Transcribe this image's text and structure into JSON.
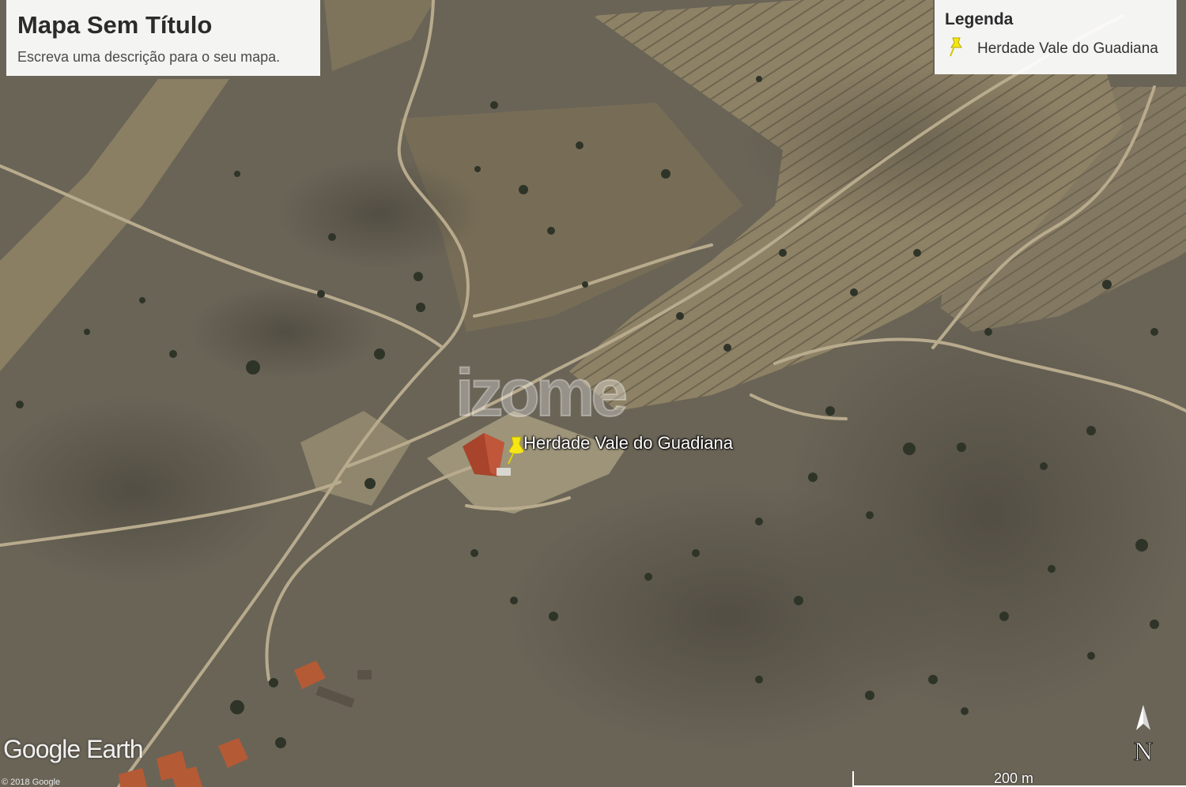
{
  "map": {
    "title": "Mapa Sem Título",
    "description": "Escreva uma descrição para o seu mapa.",
    "legend": {
      "heading": "Legenda",
      "items": [
        {
          "label": "Herdade Vale do Guadiana",
          "icon": "yellow-pushpin-icon"
        }
      ]
    },
    "placemark": {
      "label": "Herdade Vale do Guadiana",
      "icon": "yellow-pushpin-icon",
      "color": "#f5e614"
    },
    "watermark": "izome",
    "branding": {
      "logo": "Google Earth",
      "copyright": "© 2018 Google"
    },
    "compass": {
      "label": "N"
    },
    "scale_bar": {
      "label": "200 m"
    },
    "colors": {
      "terrain": "#6a6457",
      "dry_field": "#8c8065",
      "track": "#b7aa8c",
      "roof": "#a8442c"
    }
  }
}
